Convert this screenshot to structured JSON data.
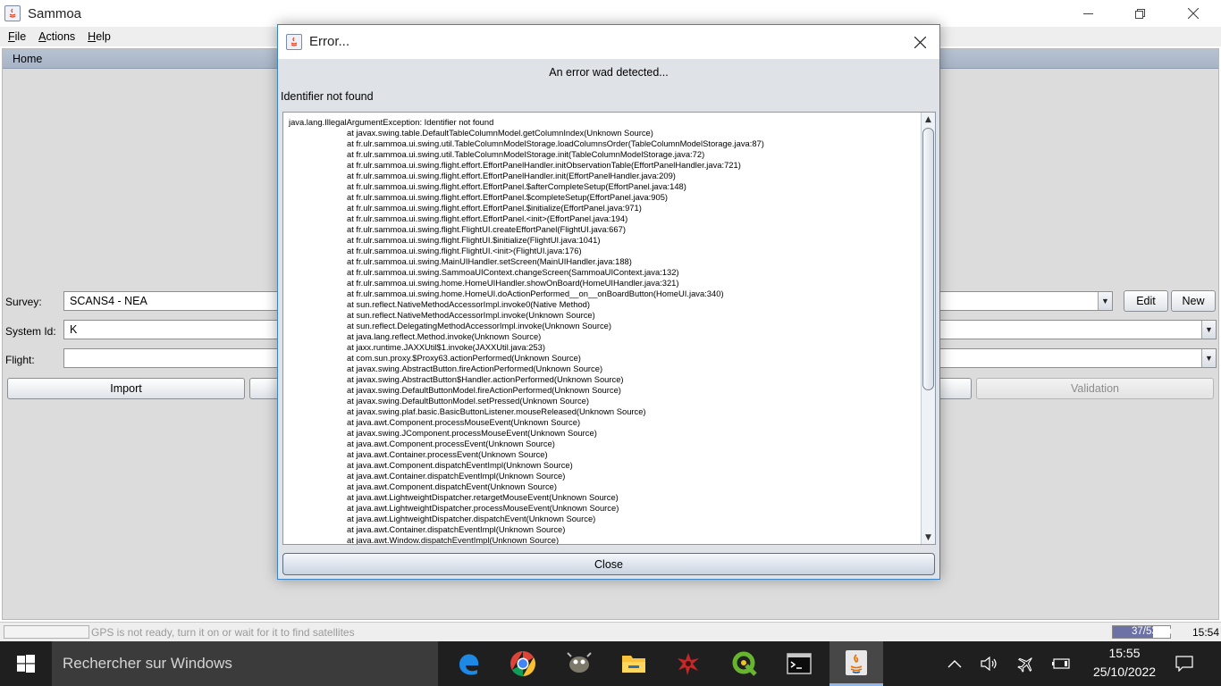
{
  "window": {
    "title": "Sammoa"
  },
  "menu": [
    {
      "label": "File",
      "mnemonic": "F",
      "rest": "ile"
    },
    {
      "label": "Actions",
      "mnemonic": "A",
      "rest": "ctions"
    },
    {
      "label": "Help",
      "mnemonic": "H",
      "rest": "elp"
    }
  ],
  "home": {
    "tab_label": "Home",
    "survey_label": "Survey:",
    "survey_value": "SCANS4 - NEA",
    "system_id_label": "System Id:",
    "system_id_value": "K",
    "flight_label": "Flight:",
    "flight_value": "",
    "edit_button": "Edit",
    "new_button": "New",
    "import_button": "Import",
    "validation_button": "Validation"
  },
  "status": {
    "gps_message": "GPS is not ready, turn it on or wait for it to find satellites",
    "memory": "37/53Mb",
    "memory_used_fraction": 0.7,
    "clock": "15:54"
  },
  "dialog": {
    "title": "Error...",
    "message": "An error wad detected...",
    "detail": "Identifier not found",
    "close_button": "Close",
    "trace": [
      "java.lang.IllegalArgumentException: Identifier not found",
      "at javax.swing.table.DefaultTableColumnModel.getColumnIndex(Unknown Source)",
      "at fr.ulr.sammoa.ui.swing.util.TableColumnModelStorage.loadColumnsOrder(TableColumnModelStorage.java:87)",
      "at fr.ulr.sammoa.ui.swing.util.TableColumnModelStorage.init(TableColumnModelStorage.java:72)",
      "at fr.ulr.sammoa.ui.swing.flight.effort.EffortPanelHandler.initObservationTable(EffortPanelHandler.java:721)",
      "at fr.ulr.sammoa.ui.swing.flight.effort.EffortPanelHandler.init(EffortPanelHandler.java:209)",
      "at fr.ulr.sammoa.ui.swing.flight.effort.EffortPanel.$afterCompleteSetup(EffortPanel.java:148)",
      "at fr.ulr.sammoa.ui.swing.flight.effort.EffortPanel.$completeSetup(EffortPanel.java:905)",
      "at fr.ulr.sammoa.ui.swing.flight.effort.EffortPanel.$initialize(EffortPanel.java:971)",
      "at fr.ulr.sammoa.ui.swing.flight.effort.EffortPanel.<init>(EffortPanel.java:194)",
      "at fr.ulr.sammoa.ui.swing.flight.FlightUI.createEffortPanel(FlightUI.java:667)",
      "at fr.ulr.sammoa.ui.swing.flight.FlightUI.$initialize(FlightUI.java:1041)",
      "at fr.ulr.sammoa.ui.swing.flight.FlightUI.<init>(FlightUI.java:176)",
      "at fr.ulr.sammoa.ui.swing.MainUIHandler.setScreen(MainUIHandler.java:188)",
      "at fr.ulr.sammoa.ui.swing.SammoaUIContext.changeScreen(SammoaUIContext.java:132)",
      "at fr.ulr.sammoa.ui.swing.home.HomeUIHandler.showOnBoard(HomeUIHandler.java:321)",
      "at fr.ulr.sammoa.ui.swing.home.HomeUI.doActionPerformed__on__onBoardButton(HomeUI.java:340)",
      "at sun.reflect.NativeMethodAccessorImpl.invoke0(Native Method)",
      "at sun.reflect.NativeMethodAccessorImpl.invoke(Unknown Source)",
      "at sun.reflect.DelegatingMethodAccessorImpl.invoke(Unknown Source)",
      "at java.lang.reflect.Method.invoke(Unknown Source)",
      "at jaxx.runtime.JAXXUtil$1.invoke(JAXXUtil.java:253)",
      "at com.sun.proxy.$Proxy63.actionPerformed(Unknown Source)",
      "at javax.swing.AbstractButton.fireActionPerformed(Unknown Source)",
      "at javax.swing.AbstractButton$Handler.actionPerformed(Unknown Source)",
      "at javax.swing.DefaultButtonModel.fireActionPerformed(Unknown Source)",
      "at javax.swing.DefaultButtonModel.setPressed(Unknown Source)",
      "at javax.swing.plaf.basic.BasicButtonListener.mouseReleased(Unknown Source)",
      "at java.awt.Component.processMouseEvent(Unknown Source)",
      "at javax.swing.JComponent.processMouseEvent(Unknown Source)",
      "at java.awt.Component.processEvent(Unknown Source)",
      "at java.awt.Container.processEvent(Unknown Source)",
      "at java.awt.Component.dispatchEventImpl(Unknown Source)",
      "at java.awt.Container.dispatchEventImpl(Unknown Source)",
      "at java.awt.Component.dispatchEvent(Unknown Source)",
      "at java.awt.LightweightDispatcher.retargetMouseEvent(Unknown Source)",
      "at java.awt.LightweightDispatcher.processMouseEvent(Unknown Source)",
      "at java.awt.LightweightDispatcher.dispatchEvent(Unknown Source)",
      "at java.awt.Container.dispatchEventImpl(Unknown Source)",
      "at java.awt.Window.dispatchEventImpl(Unknown Source)"
    ]
  },
  "taskbar": {
    "search_placeholder": "Rechercher sur Windows",
    "apps": [
      "edge-icon",
      "chrome-icon",
      "gimp-icon",
      "file-explorer-icon",
      "app-red-icon",
      "qgis-icon",
      "terminal-icon",
      "java-icon"
    ],
    "active_app": "java-icon",
    "time": "15:55",
    "date": "25/10/2022"
  },
  "colors": {
    "accent": "#3c84c6",
    "tab_bar": "#b0bccd",
    "memory_fill": "#6c71a6",
    "taskbar": "#1f1f1f"
  }
}
